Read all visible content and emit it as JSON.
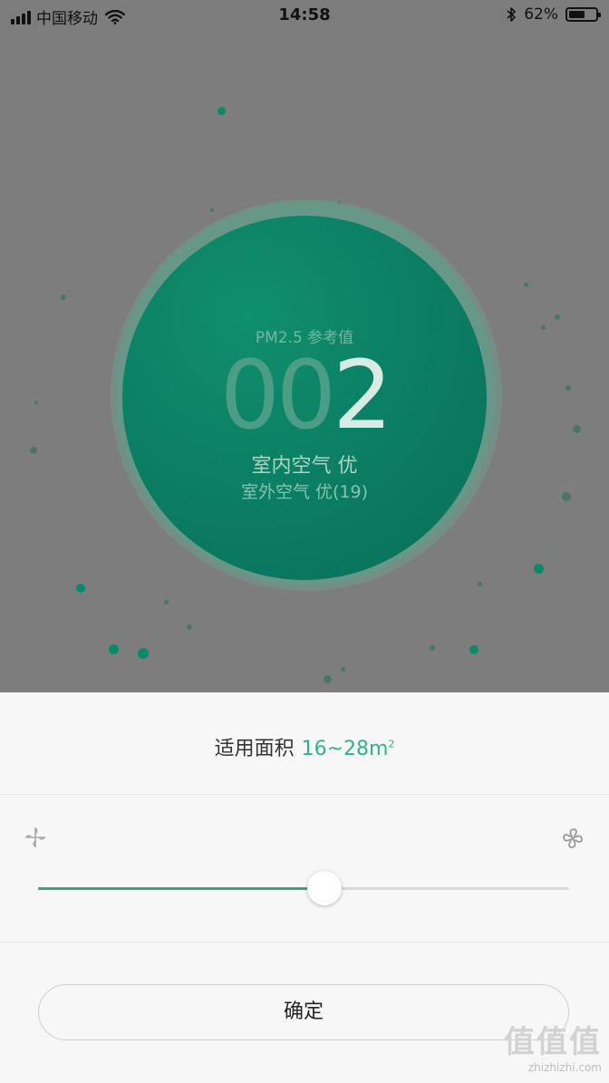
{
  "status_bar": {
    "carrier": "中国移动",
    "time": "14:58",
    "battery_percent": "62%",
    "battery_level": 0.62
  },
  "air_quality": {
    "label": "PM2.5 参考值",
    "value_leading_zeros": "00",
    "value_digit": "2",
    "indoor": "室内空气 优",
    "outdoor": "室外空气 优(19)"
  },
  "area": {
    "label": "适用面积",
    "value": "16~28m",
    "unit_sup": "2"
  },
  "fan_speed": {
    "level": 0.54,
    "low_icon": "fan-low-icon",
    "high_icon": "fan-high-icon"
  },
  "confirm_label": "确定",
  "watermark": {
    "logo": "值值值",
    "url": "zhizhizhi.com"
  },
  "colors": {
    "accent": "#2db586",
    "gauge": "#0b7c62",
    "overlay": "#7d7d7d"
  }
}
